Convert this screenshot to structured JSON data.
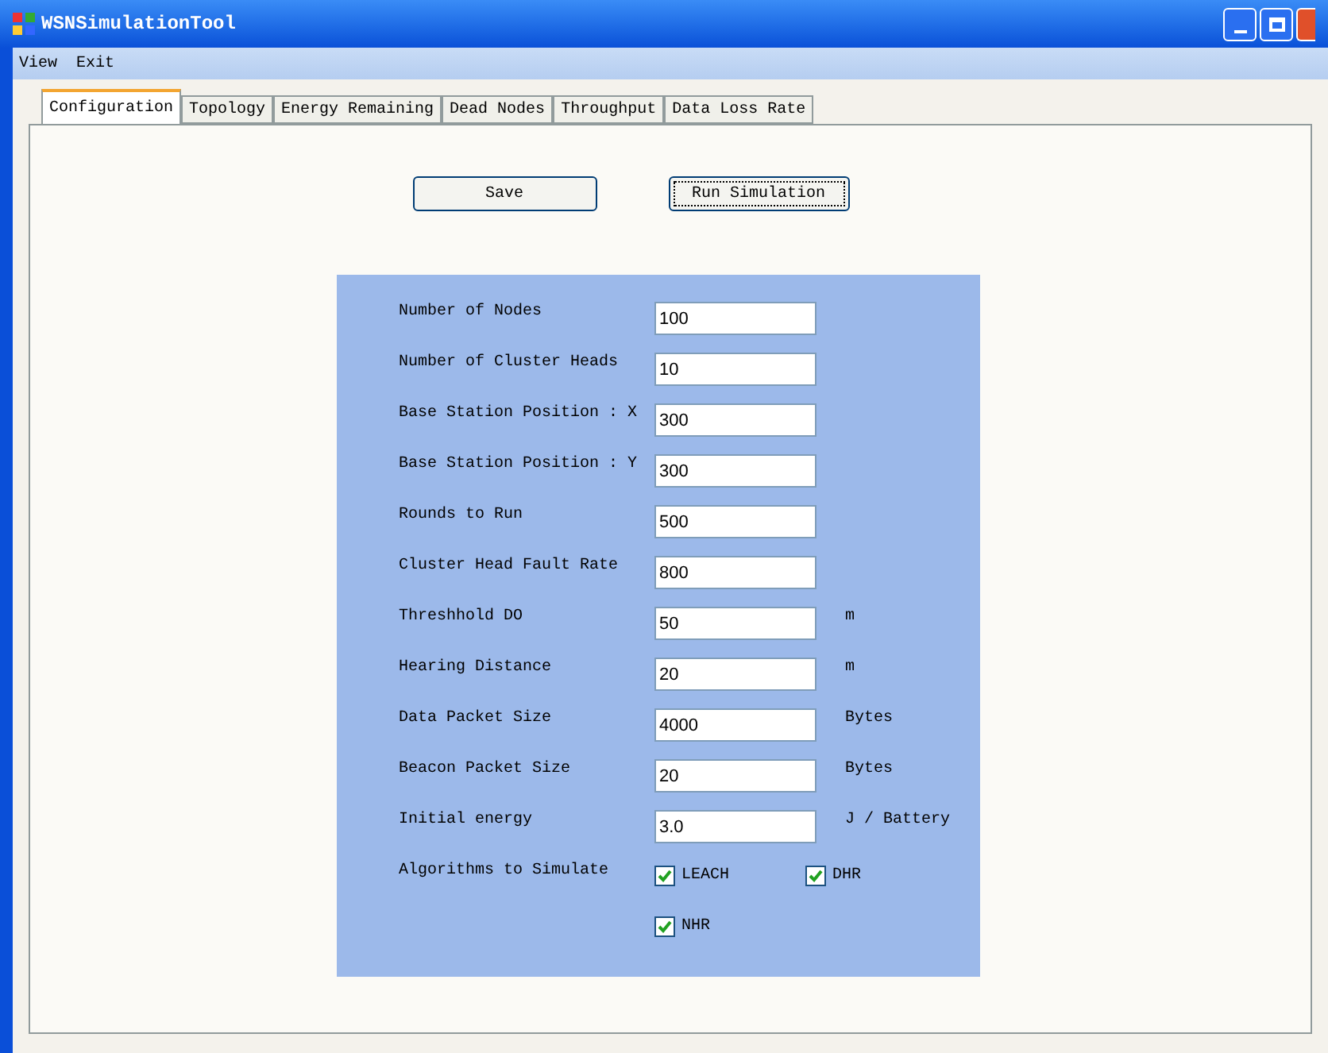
{
  "window": {
    "title": "WSNSimulationTool"
  },
  "menu": [
    "View",
    "Exit"
  ],
  "tabs": [
    {
      "label": "Configuration",
      "selected": true
    },
    {
      "label": "Topology",
      "selected": false
    },
    {
      "label": "Energy Remaining",
      "selected": false
    },
    {
      "label": "Dead Nodes",
      "selected": false
    },
    {
      "label": "Throughput",
      "selected": false
    },
    {
      "label": "Data Loss Rate",
      "selected": false
    }
  ],
  "buttons": [
    {
      "label": "Save",
      "focused": false
    },
    {
      "label": "Run Simulation",
      "focused": true
    }
  ],
  "fields": [
    {
      "label": "Number of Nodes",
      "value": "100"
    },
    {
      "label": "Number of Cluster Heads",
      "value": "10"
    },
    {
      "label": "Base Station Position : X",
      "value": "300"
    },
    {
      "label": "Base Station Position : Y",
      "value": "300"
    },
    {
      "label": "Rounds to Run",
      "value": "500"
    },
    {
      "label": "Cluster Head Fault Rate",
      "value": "800"
    },
    {
      "label": "Threshhold DO",
      "value": "50",
      "unit": "m"
    },
    {
      "label": "Hearing Distance",
      "value": "20",
      "unit": "m"
    },
    {
      "label": "Data Packet Size",
      "value": "4000",
      "unit": "Bytes"
    },
    {
      "label": "Beacon Packet Size",
      "value": "20",
      "unit": "Bytes"
    },
    {
      "label": "Initial energy",
      "value": "3.0",
      "unit": "J / Battery"
    }
  ],
  "algorithms": {
    "label": "Algorithms to Simulate",
    "options": [
      {
        "label": "LEACH",
        "checked": true
      },
      {
        "label": "DHR",
        "checked": true
      },
      {
        "label": "NHR",
        "checked": true
      }
    ]
  }
}
